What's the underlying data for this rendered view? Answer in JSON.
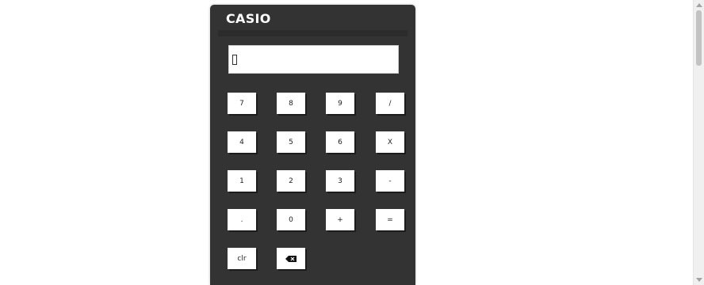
{
  "calculator": {
    "brand": "CASIO",
    "display_value": ""
  },
  "keys": {
    "k7": "7",
    "k8": "8",
    "k9": "9",
    "divide": "/",
    "k4": "4",
    "k5": "5",
    "k6": "6",
    "multiply": "X",
    "k1": "1",
    "k2": "2",
    "k3": "3",
    "minus": "-",
    "dot": ".",
    "k0": "0",
    "plus": "+",
    "equals": "=",
    "clear": "clr",
    "backspace_icon": "backspace-icon"
  },
  "colors": {
    "body": "#333333",
    "key": "#ffffff",
    "display": "#ffffff"
  }
}
